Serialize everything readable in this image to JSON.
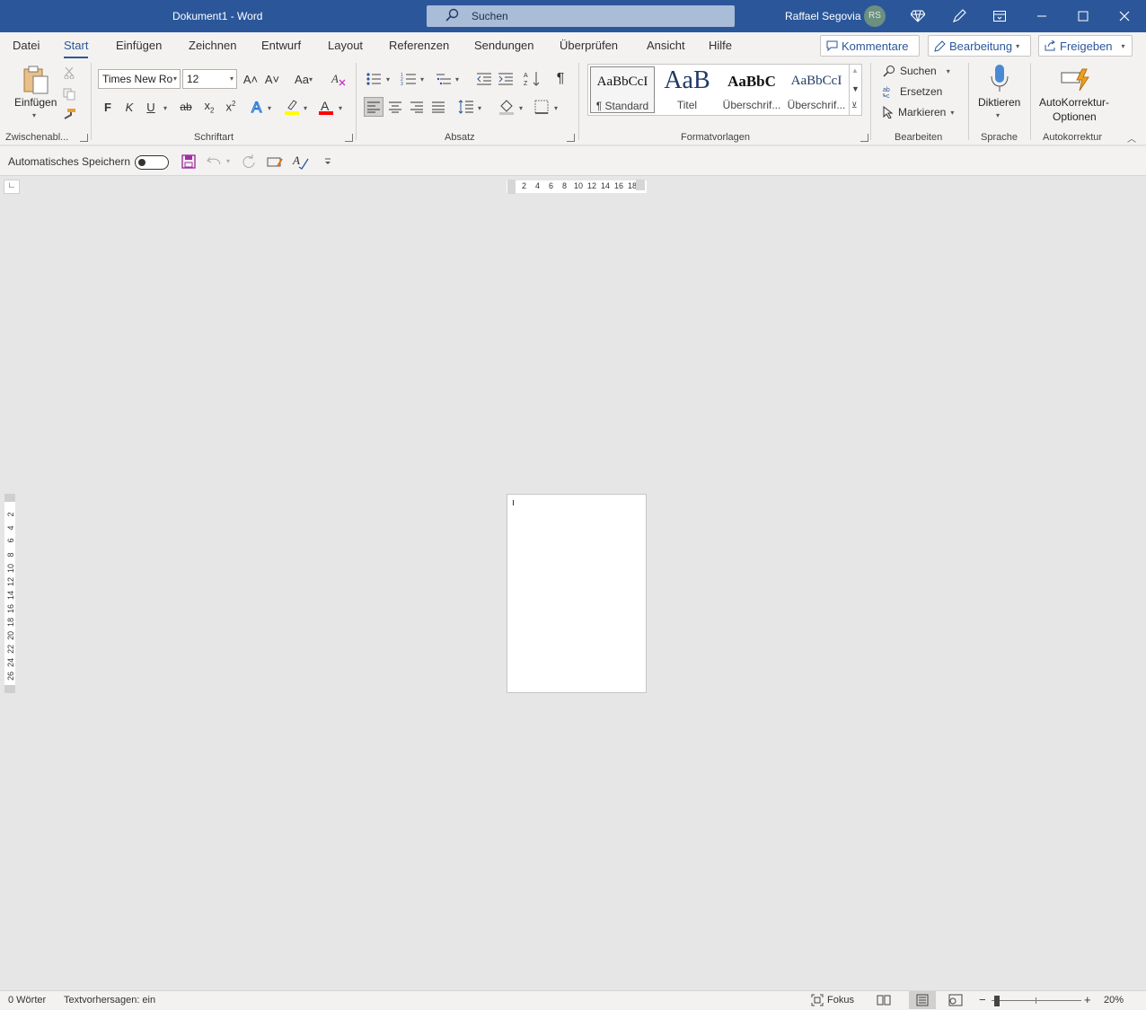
{
  "titlebar": {
    "doc_title": "Dokument1  -  Word",
    "search_placeholder": "Suchen",
    "user_name": "Raffael Segovia",
    "user_initials": "RS"
  },
  "tabs": [
    "Datei",
    "Start",
    "Einfügen",
    "Zeichnen",
    "Entwurf",
    "Layout",
    "Referenzen",
    "Sendungen",
    "Überprüfen",
    "Ansicht",
    "Hilfe"
  ],
  "tab_actions": {
    "comments": "Kommentare",
    "editing": "Bearbeitung",
    "share": "Freigeben"
  },
  "clipboard": {
    "paste_label": "Einfügen",
    "group_label": "Zwischenabl..."
  },
  "font": {
    "font_name": "Times New Ro",
    "font_size": "12",
    "group_label": "Schriftart",
    "bold": "F",
    "italic": "K",
    "underline": "U",
    "strike": "ab",
    "grow": "A˄",
    "shrink": "A˅",
    "case": "Aa",
    "font_color": "#ff0000",
    "highlight_color": "#ffff00"
  },
  "paragraph": {
    "group_label": "Absatz"
  },
  "styles": {
    "group_label": "Formatvorlagen",
    "items": [
      {
        "sample": "AaBbCcI",
        "name": "¶ Standard"
      },
      {
        "sample": "AaB",
        "name": "Titel"
      },
      {
        "sample": "AaBbC",
        "name": "Überschrif..."
      },
      {
        "sample": "AaBbCcI",
        "name": "Überschrif..."
      }
    ]
  },
  "editing": {
    "find": "Suchen",
    "replace": "Ersetzen",
    "select": "Markieren",
    "group_label": "Bearbeiten"
  },
  "voice": {
    "dictate": "Diktieren",
    "group_label": "Sprache"
  },
  "autocorrect": {
    "button_line1": "AutoKorrektur-",
    "button_line2": "Optionen",
    "group_label": "Autokorrektur"
  },
  "qat": {
    "autosave_label": "Automatisches Speichern"
  },
  "h_ruler_numbers": [
    "2",
    "4",
    "6",
    "8",
    "10",
    "12",
    "14",
    "16",
    "18"
  ],
  "v_ruler_numbers": [
    "2",
    "4",
    "6",
    "8",
    "10",
    "12",
    "14",
    "16",
    "18",
    "20",
    "22",
    "24",
    "26"
  ],
  "status": {
    "words": "0 Wörter",
    "predictions": "Textvorhersagen: ein",
    "focus": "Fokus",
    "zoom": "20%"
  },
  "colors": {
    "brand": "#2b579a",
    "ribbon_bg": "#f3f2f1",
    "canvas_bg": "#e6e6e6"
  }
}
